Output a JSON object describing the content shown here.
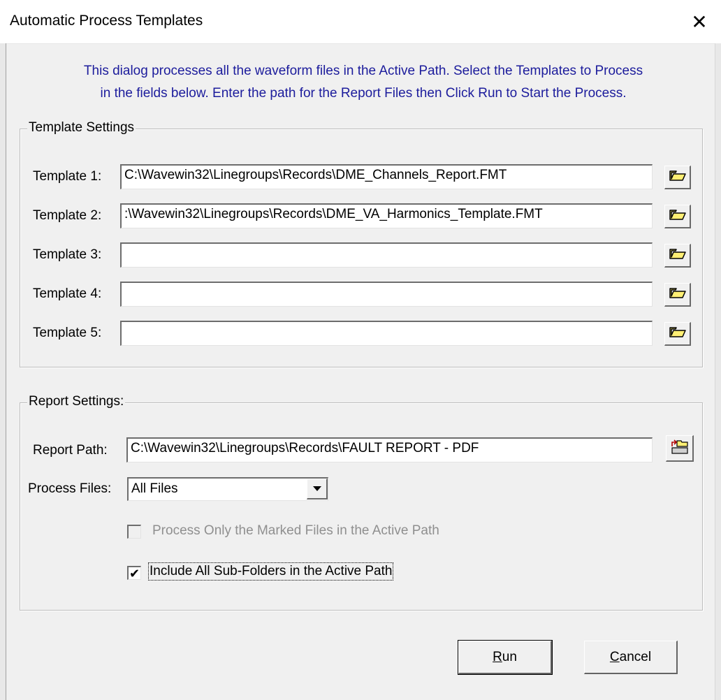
{
  "window": {
    "title": "Automatic Process Templates",
    "close_glyph": "✕"
  },
  "intro": {
    "line1": "This dialog processes all the waveform files in the Active Path. Select the Templates to Process",
    "line2": "in the fields below. Enter the path for the Report Files then Click Run to Start the Process."
  },
  "template_settings": {
    "legend": "Template Settings",
    "templates": [
      {
        "label": "Template 1:",
        "value": "C:\\Wavewin32\\Linegroups\\Records\\DME_Channels_Report.FMT",
        "icon": "open-folder-icon"
      },
      {
        "label": "Template 2:",
        "value": ":\\Wavewin32\\Linegroups\\Records\\DME_VA_Harmonics_Template.FMT",
        "icon": "open-folder-icon"
      },
      {
        "label": "Template 3:",
        "value": "",
        "icon": "open-folder-icon"
      },
      {
        "label": "Template 4:",
        "value": "",
        "icon": "open-folder-icon"
      },
      {
        "label": "Template 5:",
        "value": "",
        "icon": "open-folder-icon"
      }
    ]
  },
  "report_settings": {
    "legend": "Report Settings:",
    "report_path_label": "Report Path:",
    "report_path_value": "C:\\Wavewin32\\Linegroups\\Records\\FAULT REPORT - PDF",
    "report_path_icon": "browse-folder-icon",
    "process_files_label": "Process Files:",
    "process_files_value": "All Files",
    "marked_files_label": "Process Only the Marked Files in the Active Path",
    "marked_files_checked": false,
    "marked_files_enabled": false,
    "subfolders_label": "Include All Sub-Folders in the Active Path",
    "subfolders_checked": true,
    "check_glyph": "✔"
  },
  "buttons": {
    "run_mnemonic": "R",
    "run_rest": "un",
    "cancel_mnemonic": "C",
    "cancel_rest": "ancel"
  },
  "colors": {
    "intro_text": "#1c1c9c",
    "folder_icon_fill": "#ffef73",
    "dialog_bg": "#f0f0f0"
  }
}
